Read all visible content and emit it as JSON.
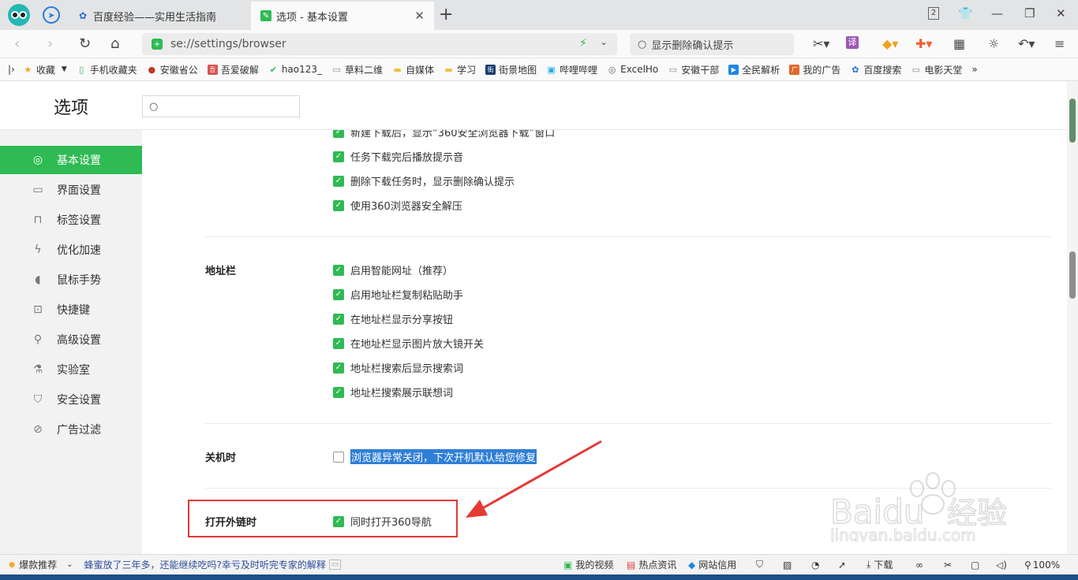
{
  "tabs": [
    {
      "label": "百度经验——实用生活指南"
    },
    {
      "label": "选项 - 基本设置"
    }
  ],
  "window": {
    "badge_count": "2"
  },
  "address": {
    "url": "se://settings/browser"
  },
  "search": {
    "text": "显示删除确认提示"
  },
  "bookmarks": [
    {
      "label": "收藏",
      "icon": "star-icon",
      "color": "#f5a623"
    },
    {
      "label": "手机收藏夹",
      "icon": "phone-icon",
      "color": "#2fba53"
    },
    {
      "label": "安徽省公",
      "icon": "emblem-icon",
      "color": "#c0392b"
    },
    {
      "label": "吾爱破解",
      "icon": "site-icon",
      "color": "#d9534f"
    },
    {
      "label": "hao123_",
      "icon": "hao-icon",
      "color": "#2fba53"
    },
    {
      "label": "草料二维",
      "icon": "doc-icon",
      "color": "#888888"
    },
    {
      "label": "自媒体",
      "icon": "folder-icon",
      "color": "#f0c040"
    },
    {
      "label": "学习",
      "icon": "folder-icon",
      "color": "#f0c040"
    },
    {
      "label": "街景地图",
      "icon": "street-icon",
      "color": "#1b3b6f"
    },
    {
      "label": "哔哩哔哩",
      "icon": "tv-icon",
      "color": "#23ade5"
    },
    {
      "label": "ExcelHo",
      "icon": "globe-icon",
      "color": "#666666"
    },
    {
      "label": "安徽干部",
      "icon": "doc-icon",
      "color": "#888888"
    },
    {
      "label": "全民解析",
      "icon": "play-icon",
      "color": "#1e88e5"
    },
    {
      "label": "我的广告",
      "icon": "ad-icon",
      "color": "#e0672a"
    },
    {
      "label": "百度搜索",
      "icon": "paw-icon",
      "color": "#2b6de0"
    },
    {
      "label": "电影天堂",
      "icon": "doc-icon",
      "color": "#888888"
    }
  ],
  "page": {
    "title": "选项",
    "search_placeholder": ""
  },
  "sidebar": [
    {
      "label": "基本设置",
      "icon": "gear-icon",
      "active": true
    },
    {
      "label": "界面设置",
      "icon": "window-icon"
    },
    {
      "label": "标签设置",
      "icon": "tab-icon"
    },
    {
      "label": "优化加速",
      "icon": "bolt-icon"
    },
    {
      "label": "鼠标手势",
      "icon": "mouse-icon"
    },
    {
      "label": "快捷键",
      "icon": "keyboard-icon"
    },
    {
      "label": "高级设置",
      "icon": "wrench-icon"
    },
    {
      "label": "实验室",
      "icon": "flask-icon"
    },
    {
      "label": "安全设置",
      "icon": "shield-icon"
    },
    {
      "label": "广告过滤",
      "icon": "block-icon"
    }
  ],
  "download_options": [
    {
      "label": "新建下载后，显示“360安全浏览器下载”窗口",
      "checked": true
    },
    {
      "label": "任务下载完后播放提示音",
      "checked": true
    },
    {
      "label": "删除下载任务时，显示删除确认提示",
      "checked": true
    },
    {
      "label": "使用360浏览器安全解压",
      "checked": true
    }
  ],
  "address_bar_section": {
    "label": "地址栏",
    "options": [
      {
        "label": "启用智能网址（推荐）",
        "checked": true
      },
      {
        "label": "启用地址栏复制粘贴助手",
        "checked": true
      },
      {
        "label": "在地址栏显示分享按钮",
        "checked": true
      },
      {
        "label": "在地址栏显示图片放大镜开关",
        "checked": true
      },
      {
        "label": "地址栏搜索后显示搜索词",
        "checked": true
      },
      {
        "label": "地址栏搜索展示联想词",
        "checked": true
      }
    ]
  },
  "shutdown_section": {
    "label": "关机时",
    "option": {
      "label": "浏览器异常关闭，下次开机默认给您修复",
      "checked": false
    }
  },
  "external_link_section": {
    "label": "打开外链时",
    "option": {
      "label": "同时打开360导航",
      "checked": true
    }
  },
  "watermark": {
    "brand": "Baidu",
    "brand_cn": "经验",
    "domain": "jingyan.baidu.com"
  },
  "status": {
    "left_label": "爆款推荐",
    "news": "蜂蜜放了三年多，还能继续吃吗?幸亏及时听完专家的解释",
    "items": [
      "我的视频",
      "热点资讯",
      "网站信用",
      "下载"
    ],
    "zoom": "100%"
  },
  "colors": {
    "accent": "#2fba53",
    "highlight": "#2f7fd6",
    "annotation": "#e53935"
  }
}
